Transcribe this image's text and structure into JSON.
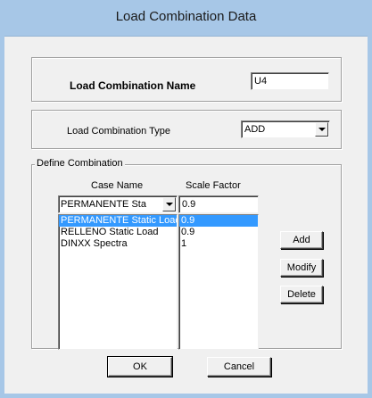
{
  "window": {
    "title": "Load Combination Data"
  },
  "name_group": {
    "label": "Load Combination Name",
    "value": "U4"
  },
  "type_group": {
    "label": "Load Combination Type",
    "selected": "ADD"
  },
  "define": {
    "legend": "Define Combination",
    "col_case": "Case Name",
    "col_scale": "Scale Factor",
    "case_input": "PERMANENTE Sta",
    "scale_input": "0.9",
    "rows": [
      {
        "case": "PERMANENTE Static Load",
        "scale": "0.9",
        "selected": true
      },
      {
        "case": "RELLENO Static Load",
        "scale": "0.9",
        "selected": false
      },
      {
        "case": "DINXX Spectra",
        "scale": "1",
        "selected": false
      }
    ],
    "add_label": "Add",
    "modify_label": "Modify",
    "delete_label": "Delete"
  },
  "footer": {
    "ok_label": "OK",
    "cancel_label": "Cancel"
  },
  "colors": {
    "titlebar": "#a7c7e7",
    "selection": "#3399ff",
    "dialog": "#f0f0f0"
  }
}
